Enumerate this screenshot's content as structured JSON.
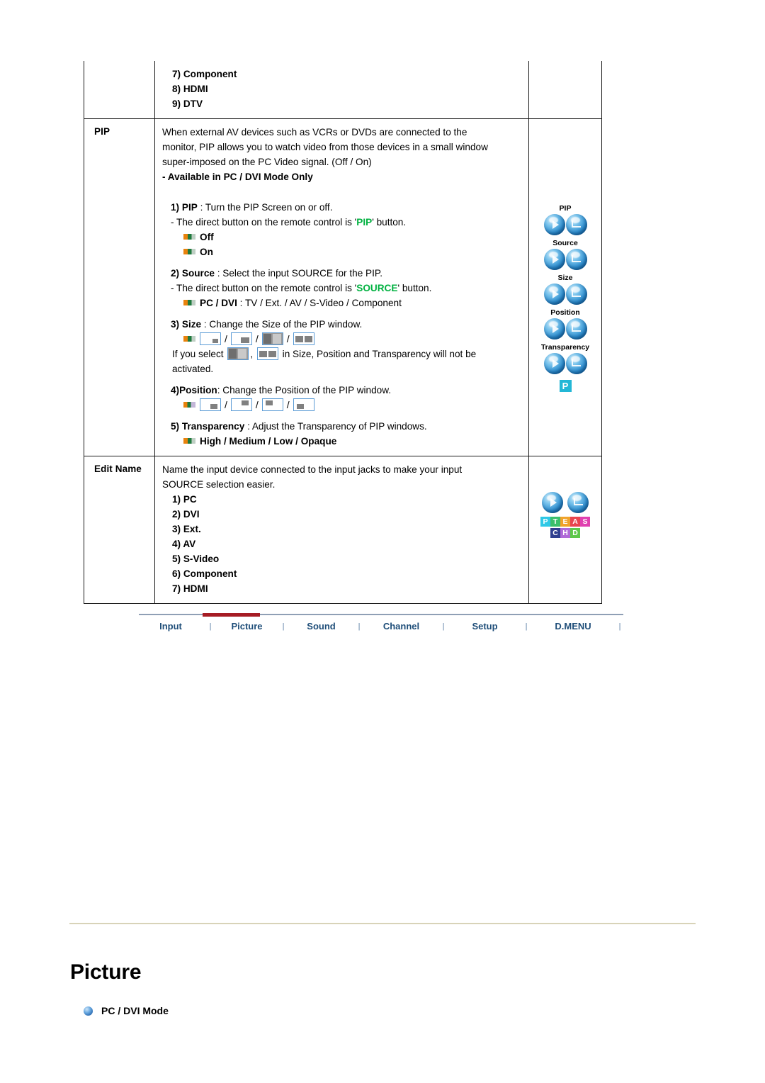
{
  "table": {
    "rows": [
      {
        "label": "",
        "items": [
          "7) Component",
          "8) HDMI",
          "9) DTV"
        ]
      },
      {
        "label": "PIP",
        "intro_lines": [
          "When external AV devices such as VCRs or DVDs are connected to the",
          "monitor, PIP allows you to watch video from those devices in a small window",
          "super-imposed on the PC Video signal. (Off / On)"
        ],
        "intro_bold": "- Available in PC / DVI Mode Only",
        "item1": {
          "num": "1)",
          "kw": "PIP",
          "rest": ": Turn the PIP Screen on or off.",
          "note_pre": "- The direct button on the remote control is '",
          "note_green": "PIP",
          "note_post": "' button.",
          "options": [
            "Off",
            "On"
          ]
        },
        "item2": {
          "num": "2)",
          "kw": "Source",
          "rest": ": Select the input SOURCE for the PIP.",
          "note_pre": "- The direct button on the remote control is '",
          "note_green": "SOURCE",
          "note_post": "' button.",
          "opt_bold": "PC / DVI",
          "opt_rest": ": TV / Ext. / AV / S-Video / Component"
        },
        "item3": {
          "num": "3)",
          "kw": "Size",
          "rest": ": Change the Size of the PIP window.",
          "note_a": "If you select",
          "note_b": ",",
          "note_c": "in Size, Position and Transparency will not be",
          "note_d": "activated."
        },
        "item4": {
          "num": "4)",
          "kw": "Position",
          "rest": ": Change the Position of the PIP window."
        },
        "item5": {
          "num": "5)",
          "kw": "Transparency",
          "rest": ": Adjust the Transparency of PIP windows.",
          "options": "High / Medium / Low / Opaque"
        },
        "icons": {
          "captions": [
            "PIP",
            "Source",
            "Size",
            "Position",
            "Transparency"
          ],
          "badge": "P"
        }
      },
      {
        "label": "Edit Name",
        "intro_lines": [
          "Name the input device connected to the input jacks to make your input",
          "SOURCE selection easier."
        ],
        "items": [
          "1) PC",
          "2) DVI",
          "3) Ext.",
          "4) AV",
          "5) S-Video",
          "6) Component",
          "7) HDMI"
        ],
        "tiles_row1": [
          {
            "letter": "P",
            "color": "#2ec8e6"
          },
          {
            "letter": "T",
            "color": "#3bbf6a"
          },
          {
            "letter": "E",
            "color": "#f0a32a"
          },
          {
            "letter": "A",
            "color": "#e8454f"
          },
          {
            "letter": "S",
            "color": "#e040b0"
          }
        ],
        "tiles_row2": [
          {
            "letter": "C",
            "color": "#2f3f8f"
          },
          {
            "letter": "H",
            "color": "#b06ad8"
          },
          {
            "letter": "D",
            "color": "#5ec84a"
          }
        ]
      }
    ]
  },
  "tabbar": {
    "tabs": [
      {
        "label": "Input",
        "active": false
      },
      {
        "label": "Picture",
        "active": true
      },
      {
        "label": "Sound",
        "active": false
      },
      {
        "label": "Channel",
        "active": false
      },
      {
        "label": "Setup",
        "active": false
      },
      {
        "label": "D.MENU",
        "active": false
      }
    ],
    "separator": "|",
    "active_color": "#a61c24",
    "text_color": "#1f4e79"
  },
  "bottom": {
    "heading": "Picture",
    "bullet_label": "PC / DVI Mode"
  }
}
